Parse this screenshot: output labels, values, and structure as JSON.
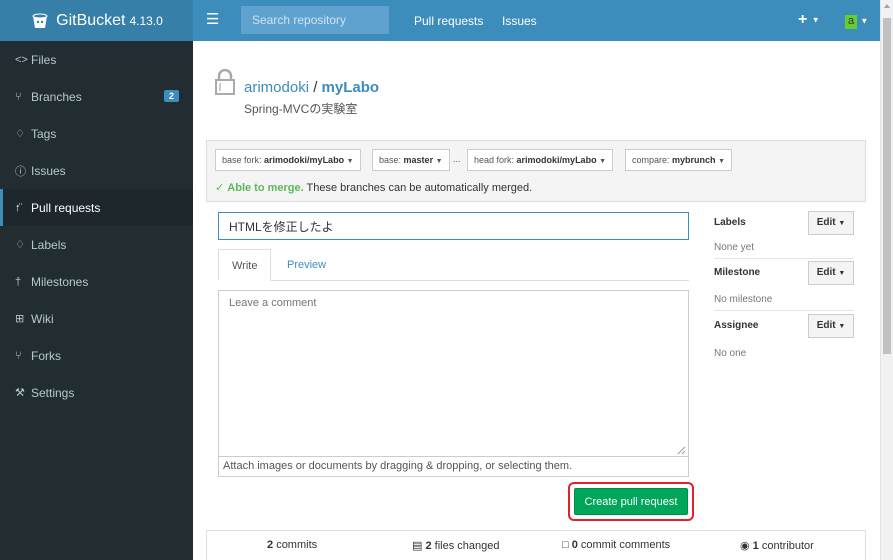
{
  "header": {
    "app_name": "GitBucket",
    "version": "4.13.0",
    "search_placeholder": "Search repository",
    "nav": [
      "Pull requests",
      "Issues"
    ],
    "plus": "+",
    "avatar_letter": "a"
  },
  "sidebar": {
    "items": [
      {
        "label": "Files",
        "icon": "code-icon",
        "glyph": "<>"
      },
      {
        "label": "Branches",
        "icon": "branch-icon",
        "glyph": "⑂",
        "badge": "2"
      },
      {
        "label": "Tags",
        "icon": "tag-icon",
        "glyph": "♢"
      },
      {
        "label": "Issues",
        "icon": "issue-icon",
        "glyph": "ⓘ"
      },
      {
        "label": "Pull requests",
        "icon": "pull-request-icon",
        "glyph": "↑̈",
        "active": true
      },
      {
        "label": "Labels",
        "icon": "label-icon",
        "glyph": "♢"
      },
      {
        "label": "Milestones",
        "icon": "milestone-icon",
        "glyph": "†"
      },
      {
        "label": "Wiki",
        "icon": "wiki-icon",
        "glyph": "⊞"
      },
      {
        "label": "Forks",
        "icon": "fork-icon",
        "glyph": "⑂"
      },
      {
        "label": "Settings",
        "icon": "settings-icon",
        "glyph": "⚒"
      }
    ]
  },
  "repo": {
    "owner": "arimodoki",
    "name": "myLabo",
    "description": "Spring-MVCの実験室"
  },
  "compare": {
    "base_fork_prefix": "base fork:",
    "base_fork": "arimodoki/myLabo",
    "base_prefix": "base:",
    "base": "master",
    "ellipsis": "...",
    "head_fork_prefix": "head fork:",
    "head_fork": "arimodoki/myLabo",
    "compare_prefix": "compare:",
    "compare": "mybrunch",
    "merge_status": "Able to merge.",
    "merge_message": "These branches can be automatically merged."
  },
  "form": {
    "title_value": "HTMLを修正したよ",
    "tab_write": "Write",
    "tab_preview": "Preview",
    "comment_placeholder": "Leave a comment",
    "attach_hint": "Attach images or documents by dragging & dropping, or selecting them.",
    "create_label": "Create pull request"
  },
  "side": {
    "labels_title": "Labels",
    "labels_value": "None yet",
    "milestone_title": "Milestone",
    "milestone_value": "No milestone",
    "assignee_title": "Assignee",
    "assignee_value": "No one",
    "edit_label": "Edit"
  },
  "stats": {
    "commits_count": "2",
    "commits_label": "commits",
    "files_count": "2",
    "files_label": "files changed",
    "comments_count": "0",
    "comments_label": "commit comments",
    "contributors_count": "1",
    "contributors_label": "contributor"
  },
  "colors": {
    "topbar": "#3c8dbc",
    "sidebar": "#222d32",
    "accent": "#3c8dbc",
    "success": "#00a65a",
    "highlight": "#e4202a"
  }
}
